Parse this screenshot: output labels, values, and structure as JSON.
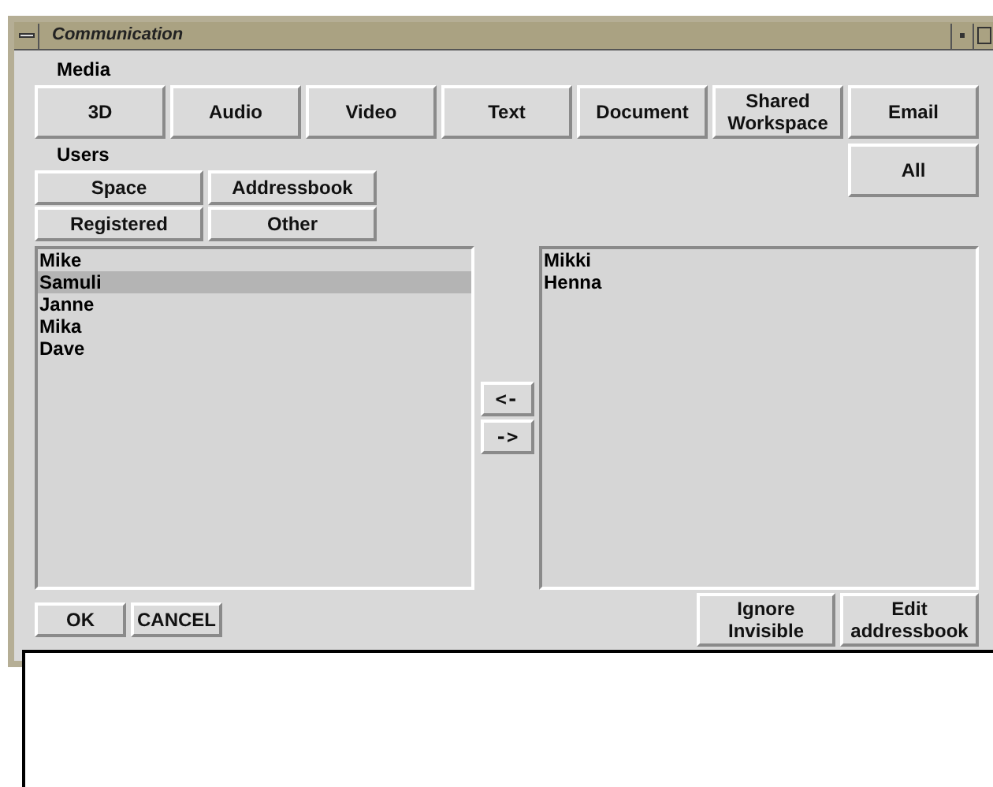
{
  "window": {
    "title": "Communication"
  },
  "media": {
    "label": "Media",
    "buttons": [
      "3D",
      "Audio",
      "Video",
      "Text",
      "Document",
      "Shared Workspace",
      "Email"
    ]
  },
  "users": {
    "label": "Users",
    "buttons": [
      "Space",
      "Addressbook",
      "Registered",
      "Other"
    ],
    "all_button": "All"
  },
  "available_list": [
    {
      "name": "Mike",
      "selected": false
    },
    {
      "name": "Samuli",
      "selected": true
    },
    {
      "name": "Janne",
      "selected": false
    },
    {
      "name": "Mika",
      "selected": false
    },
    {
      "name": "Dave",
      "selected": false
    }
  ],
  "move_buttons": [
    "<-",
    "->"
  ],
  "chosen_list": [
    {
      "name": "Mikki",
      "selected": false
    },
    {
      "name": "Henna",
      "selected": false
    }
  ],
  "footer": {
    "left_buttons": [
      "OK",
      "CANCEL"
    ],
    "right_buttons": [
      "Ignore Invisible",
      "Edit addressbook"
    ]
  }
}
